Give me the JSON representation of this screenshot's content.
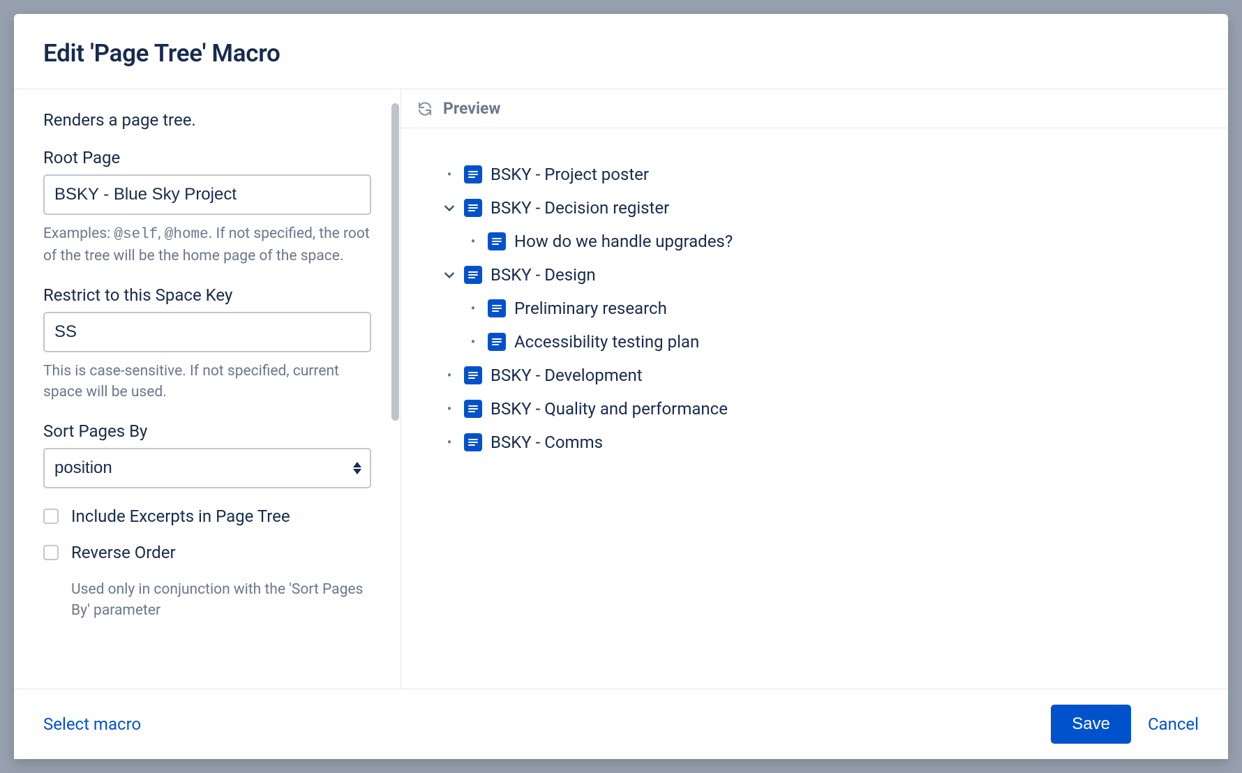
{
  "dialog": {
    "title": "Edit 'Page Tree' Macro",
    "description": "Renders a page tree."
  },
  "fields": {
    "rootPage": {
      "label": "Root Page",
      "value": "BSKY - Blue Sky Project",
      "help_prefix": "Examples: ",
      "help_ex1": "@self",
      "help_mid": ", ",
      "help_ex2": "@home",
      "help_suffix": ". If not specified, the root of the tree will be the home page of the space."
    },
    "spaceKey": {
      "label": "Restrict to this Space Key",
      "value": "SS",
      "help": "This is case-sensitive. If not specified, current space will be used."
    },
    "sort": {
      "label": "Sort Pages By",
      "value": "position"
    },
    "includeExcerpts": {
      "label": "Include Excerpts in Page Tree"
    },
    "reverseOrder": {
      "label": "Reverse Order",
      "help": "Used only in conjunction with the 'Sort Pages By' parameter"
    }
  },
  "preview": {
    "label": "Preview",
    "tree": [
      {
        "label": "BSKY - Project poster",
        "marker": "bullet"
      },
      {
        "label": "BSKY - Decision register",
        "marker": "chevron",
        "children": [
          {
            "label": "How do we handle upgrades?",
            "marker": "bullet"
          }
        ]
      },
      {
        "label": "BSKY - Design",
        "marker": "chevron",
        "children": [
          {
            "label": "Preliminary research",
            "marker": "bullet"
          },
          {
            "label": "Accessibility testing plan",
            "marker": "bullet"
          }
        ]
      },
      {
        "label": "BSKY - Development",
        "marker": "bullet"
      },
      {
        "label": "BSKY - Quality and performance",
        "marker": "bullet"
      },
      {
        "label": "BSKY - Comms",
        "marker": "bullet"
      }
    ]
  },
  "footer": {
    "selectMacro": "Select macro",
    "save": "Save",
    "cancel": "Cancel"
  }
}
